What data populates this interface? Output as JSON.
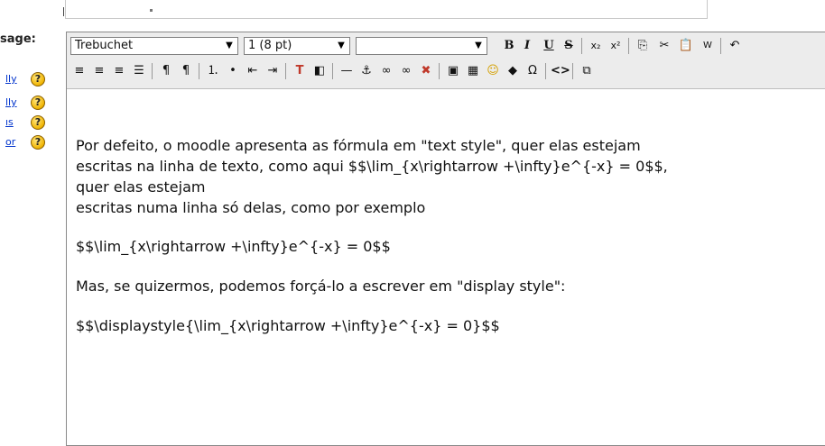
{
  "left": {
    "message_label": "sage:",
    "help_links": [
      {
        "text": "lly"
      },
      {
        "text": "lly"
      },
      {
        "text": "ıs"
      },
      {
        "text": "or"
      }
    ],
    "help_icon_glyph": "?"
  },
  "toolbar": {
    "font_family": "Trebuchet",
    "font_size": "1 (8 pt)",
    "heading": "",
    "dropdown_arrow": "▼",
    "row1": [
      "B",
      "I",
      "U",
      "S",
      "x₂",
      "x²",
      "copy",
      "cut",
      "paste",
      "paste-word",
      "undo"
    ],
    "row2": [
      "align-left",
      "align-center",
      "align-right",
      "justify",
      "ltr",
      "rtl",
      "ordered-list",
      "unordered-list",
      "outdent",
      "indent",
      "text-color",
      "bg-color",
      "hr",
      "anchor",
      "link",
      "unlink",
      "nolink",
      "image",
      "table",
      "smiley",
      "search",
      "special-char",
      "source",
      "fullscreen"
    ]
  },
  "content": {
    "line1": "Por defeito, o moodle apresenta as fórmula em \"text style\", quer elas estejam",
    "line2": "escritas na linha de texto, como aqui $$\\lim_{x\\rightarrow +\\infty}e^{-x} = 0$$,",
    "line3": "quer elas estejam",
    "line4": "escritas numa linha só delas, como por exemplo",
    "line5": "$$\\lim_{x\\rightarrow +\\infty}e^{-x} = 0$$",
    "line6": "Mas, se quizermos, podemos forçá-lo a escrever em \"display style\":",
    "line7": "$$\\displaystyle{\\lim_{x\\rightarrow +\\infty}e^{-x} = 0}$$"
  }
}
